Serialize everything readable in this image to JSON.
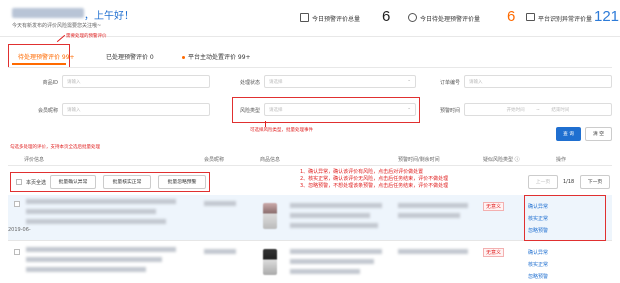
{
  "header": {
    "greeting": "，上午好！",
    "notice": "今天有新发布的评价风险需要您关注哦~",
    "stats": [
      {
        "label": "今日预警评价总量",
        "value": "6"
      },
      {
        "label": "今日待处理预警评价量",
        "value": "6"
      },
      {
        "label": "平台识别异常评价量",
        "value": "121"
      }
    ]
  },
  "annotations": {
    "tabs_note": "需要处理的预警评价",
    "risk_note": "可选择风险类型，批量处理事件",
    "batch_note": "勾选多处理的评价，支持本页全选后批量处理",
    "actions_notes": [
      "1、确认异常，确认该评价有风险，点击后对评价做处置",
      "2、核实正常，确认该评价无风险，点击后任务结束，评价不做处理",
      "3、忽略预警，不想处理该条预警，点击后任务结束，评价不做处理"
    ]
  },
  "tabs": [
    {
      "label": "待处理预警评价 99+"
    },
    {
      "label": "已处理预警评价 0"
    },
    {
      "label": "平台主动处置评价 99+"
    }
  ],
  "filters": {
    "product_id": {
      "label": "商品ID",
      "placeholder": "请输入"
    },
    "status": {
      "label": "处理状态",
      "placeholder": "请选择"
    },
    "order_no": {
      "label": "订单编号",
      "placeholder": "请输入"
    },
    "member": {
      "label": "会员昵称",
      "placeholder": "请输入"
    },
    "risk_type": {
      "label": "风险类型",
      "placeholder": "请选择"
    },
    "warn_time": {
      "label": "预警时间",
      "start": "开始时间",
      "sep": "~",
      "end": "结束时间"
    },
    "query": "查 询",
    "clear": "清 空"
  },
  "table": {
    "columns": [
      "评价信息",
      "会员昵称",
      "商品信息",
      "预警时间/剩余时间",
      "疑似风险类型",
      "操作"
    ],
    "select_all": "本页全选",
    "batch_buttons": [
      "批量确认异常",
      "批量核实正常",
      "批量忽略预警"
    ],
    "pager": {
      "prev": "上一页",
      "page": "1/18",
      "next": "下一页"
    },
    "rows": [
      {
        "date": "2019-06-",
        "risk": "无意义",
        "actions": [
          "确认异常",
          "核实正常",
          "忽略预警"
        ]
      },
      {
        "date": "",
        "risk": "无意义",
        "actions": [
          "确认异常",
          "核实正常",
          "忽略预警"
        ]
      }
    ]
  },
  "colors": {
    "accent": "#ff6a00",
    "primary": "#1f6fd0",
    "annotation": "#e02020"
  }
}
